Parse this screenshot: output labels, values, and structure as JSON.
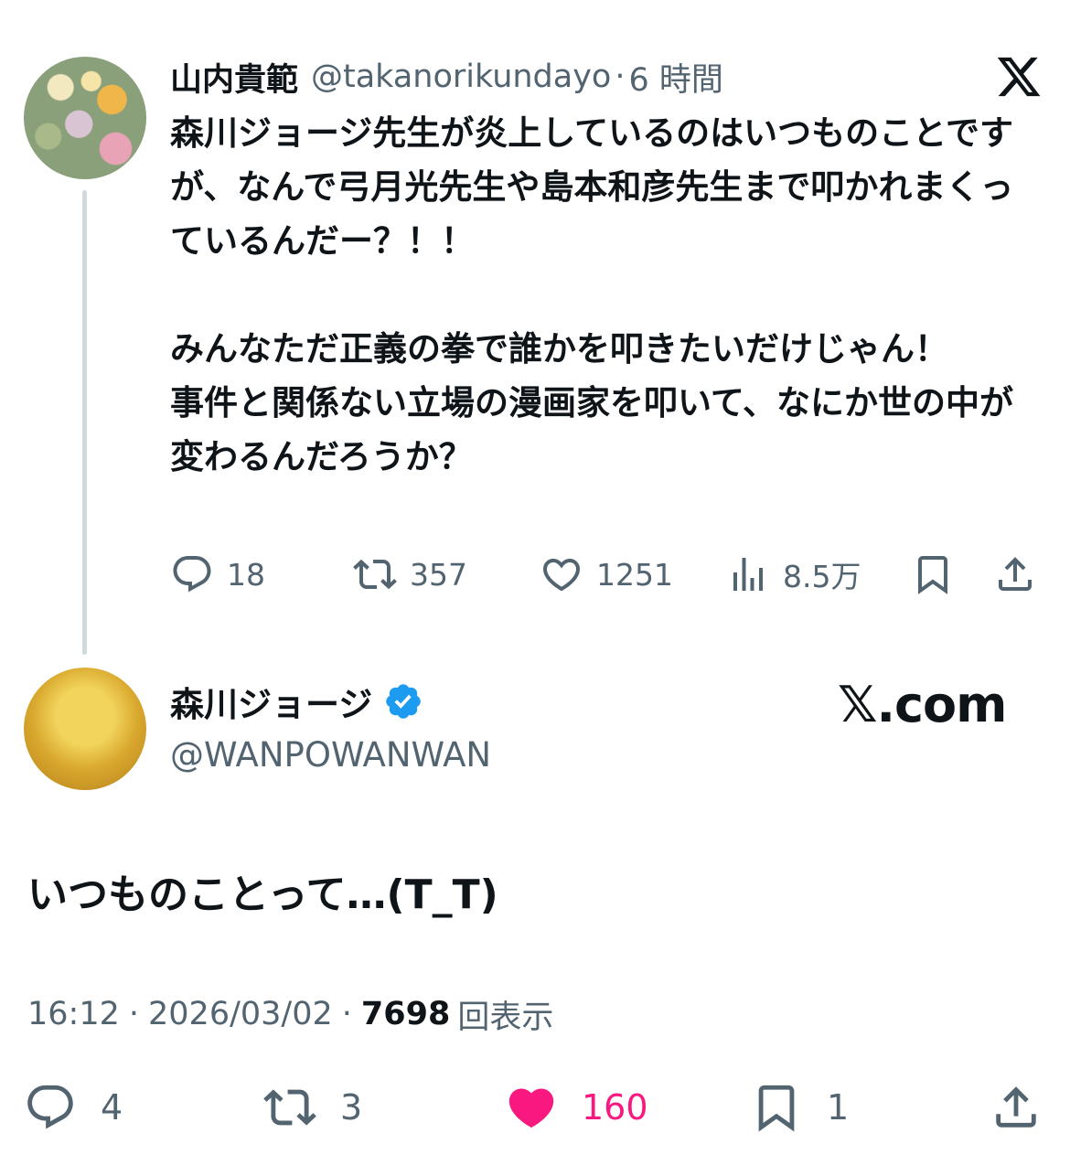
{
  "parent_tweet": {
    "author_name": "山内貴範",
    "author_handle": "@takanorikundayo",
    "separator": "·",
    "time_ago": "6 時間",
    "text": "森川ジョージ先生が炎上しているのはいつものことですが、なんで弓月光先生や島本和彦先生まで叩かれまくっているんだー？！！\n\nみんなただ正義の拳で誰かを叩きたいだけじゃん！\n事件と関係ない立場の漫画家を叩いて、なにか世の中が変わるんだろうか？",
    "replies": "18",
    "reposts": "357",
    "likes": "1251",
    "views": "8.5万"
  },
  "main_tweet": {
    "author_name": "森川ジョージ",
    "author_handle": "@WANPOWANWAN",
    "source_label": "𝕏.com",
    "text": "いつものことって…(T_T)",
    "time": "16:12",
    "date": "2026/03/02",
    "dot": "·",
    "views": "7698",
    "views_label": "回表示",
    "replies": "4",
    "reposts": "3",
    "likes": "160",
    "bookmarks": "1"
  },
  "icons": {
    "x_logo": "x-logo-icon",
    "reply": "reply-icon",
    "repost": "repost-icon",
    "like": "heart-icon",
    "views": "analytics-icon",
    "bookmark": "bookmark-icon",
    "share": "share-icon",
    "verified": "verified-badge-icon"
  },
  "colors": {
    "text": "#0f1419",
    "secondary": "#536471",
    "like_active": "#f91880",
    "verified": "#1d9bf0",
    "thread_line": "#cfd9de"
  }
}
